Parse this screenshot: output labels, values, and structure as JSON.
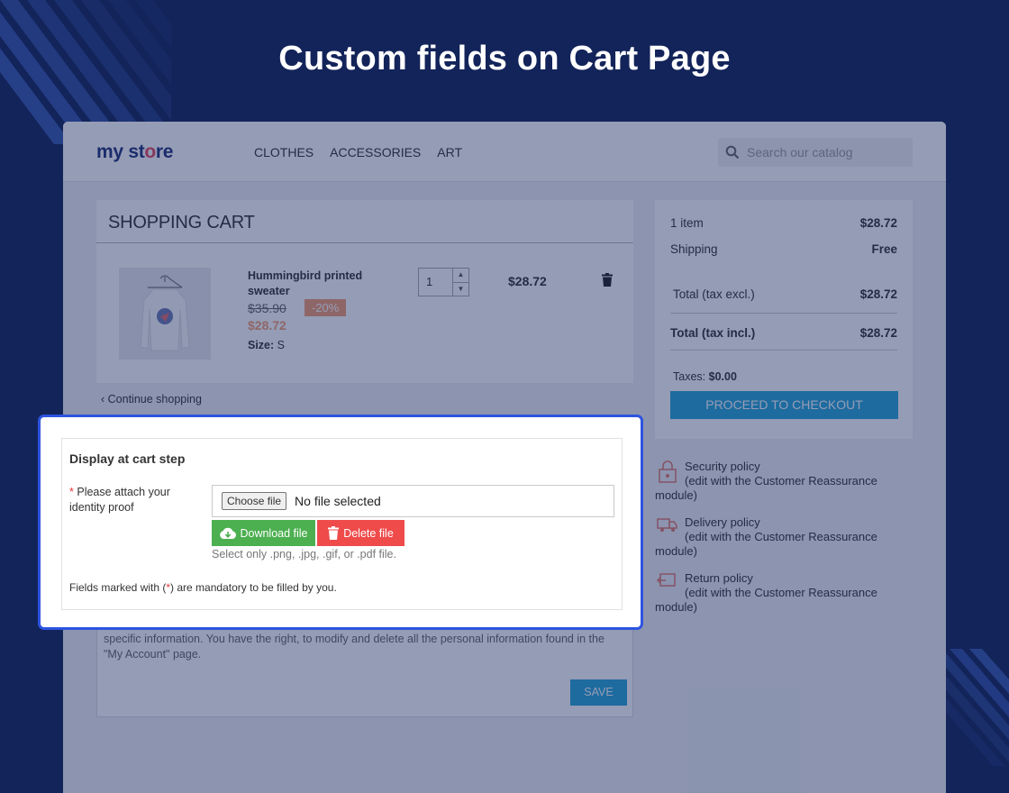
{
  "banner": {
    "title": "Custom fields on Cart Page"
  },
  "store": {
    "logo_part1": "my",
    "logo_part2": "st",
    "logo_part3": "o",
    "logo_part4": "re",
    "nav": [
      "CLOTHES",
      "ACCESSORIES",
      "ART"
    ],
    "search_placeholder": "Search our catalog"
  },
  "cart": {
    "title": "SHOPPING CART",
    "product": {
      "name": "Hummingbird printed sweater",
      "old_price": "$35.90",
      "discount": "-20%",
      "new_price": "$28.72",
      "size_label": "Size:",
      "size_value": "S",
      "quantity": "1",
      "line_total": "$28.72"
    },
    "continue_label": "Continue shopping"
  },
  "summary": {
    "items_label": "1 item",
    "items_value": "$28.72",
    "shipping_label": "Shipping",
    "shipping_value": "Free",
    "total_excl_label": "Total (tax excl.)",
    "total_excl_value": "$28.72",
    "total_incl_label": "Total (tax incl.)",
    "total_incl_value": "$28.72",
    "taxes_label": "Taxes:",
    "taxes_value": "$0.00",
    "checkout_label": "PROCEED TO CHECKOUT"
  },
  "reassurance": [
    {
      "title": "Security policy",
      "sub": "(edit with the Customer Reassurance module)"
    },
    {
      "title": "Delivery policy",
      "sub": "(edit with the Customer Reassurance module)"
    },
    {
      "title": "Return policy",
      "sub": "(edit with the Customer Reassurance module)"
    }
  ],
  "gdpr": {
    "text": "specific information. You have the right, to modify and delete all the personal information found in the \"My Account\" page.",
    "save_label": "SAVE"
  },
  "popup": {
    "title": "Display at cart step",
    "required_mark": "*",
    "field_label": "Please attach your identity proof",
    "choose_file_label": "Choose file",
    "no_file_text": "No file selected",
    "download_label": "Download file",
    "delete_label": "Delete file",
    "hint": "Select only .png, .jpg, .gif, or .pdf file.",
    "mandatory_pre": "Fields marked with (",
    "mandatory_mark": "*",
    "mandatory_post": ") are mandatory to be filled by you."
  },
  "colors": {
    "background": "#13245a",
    "highlight_border": "#2d54e0",
    "checkout": "#26a7d8",
    "download": "#4caf50",
    "delete": "#ef4b4b",
    "discount": "#f39d72"
  }
}
